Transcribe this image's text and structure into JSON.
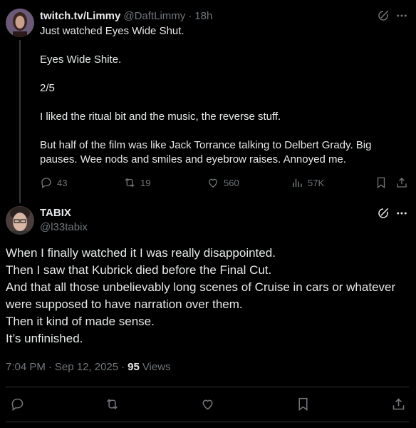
{
  "parent_post": {
    "display_name": "twitch.tv/Limmy",
    "handle": "@DaftLimmy",
    "separator": "·",
    "time": "18h",
    "paragraphs": [
      "Just watched Eyes Wide Shut.",
      "Eyes Wide Shite.",
      "2/5",
      "I liked the ritual bit and the music, the reverse stuff.",
      "But half of the film was like Jack Torrance talking to Delbert Grady. Big pauses. Wee nods and smiles and eyebrow raises. Annoyed me."
    ],
    "metrics": {
      "replies": "43",
      "reposts": "19",
      "likes": "560",
      "views": "57K"
    }
  },
  "main_post": {
    "display_name": "TABIX",
    "handle": "@l33tabix",
    "lines": [
      "When I finally watched it I was really disappointed.",
      "Then I saw that Kubrick died before the Final Cut.",
      "And that all those unbelievably long scenes of Cruise in cars or whatever were supposed to have narration over them.",
      "Then it kind of made sense.",
      "It’s unfinished."
    ],
    "time": "7:04 PM",
    "separator1": "·",
    "date": "Sep 12, 2025",
    "separator2": "·",
    "views_count": "95",
    "views_label": "Views"
  },
  "icons": {
    "grok": "grok-icon",
    "more": "more-icon",
    "reply": "reply-icon",
    "repost": "repost-icon",
    "like": "heart-icon",
    "views": "views-icon",
    "bookmark": "bookmark-icon",
    "share": "share-icon"
  },
  "colors": {
    "background": "#000000",
    "text": "#e7e9ea",
    "muted": "#71767b",
    "divider": "#2f3336"
  }
}
